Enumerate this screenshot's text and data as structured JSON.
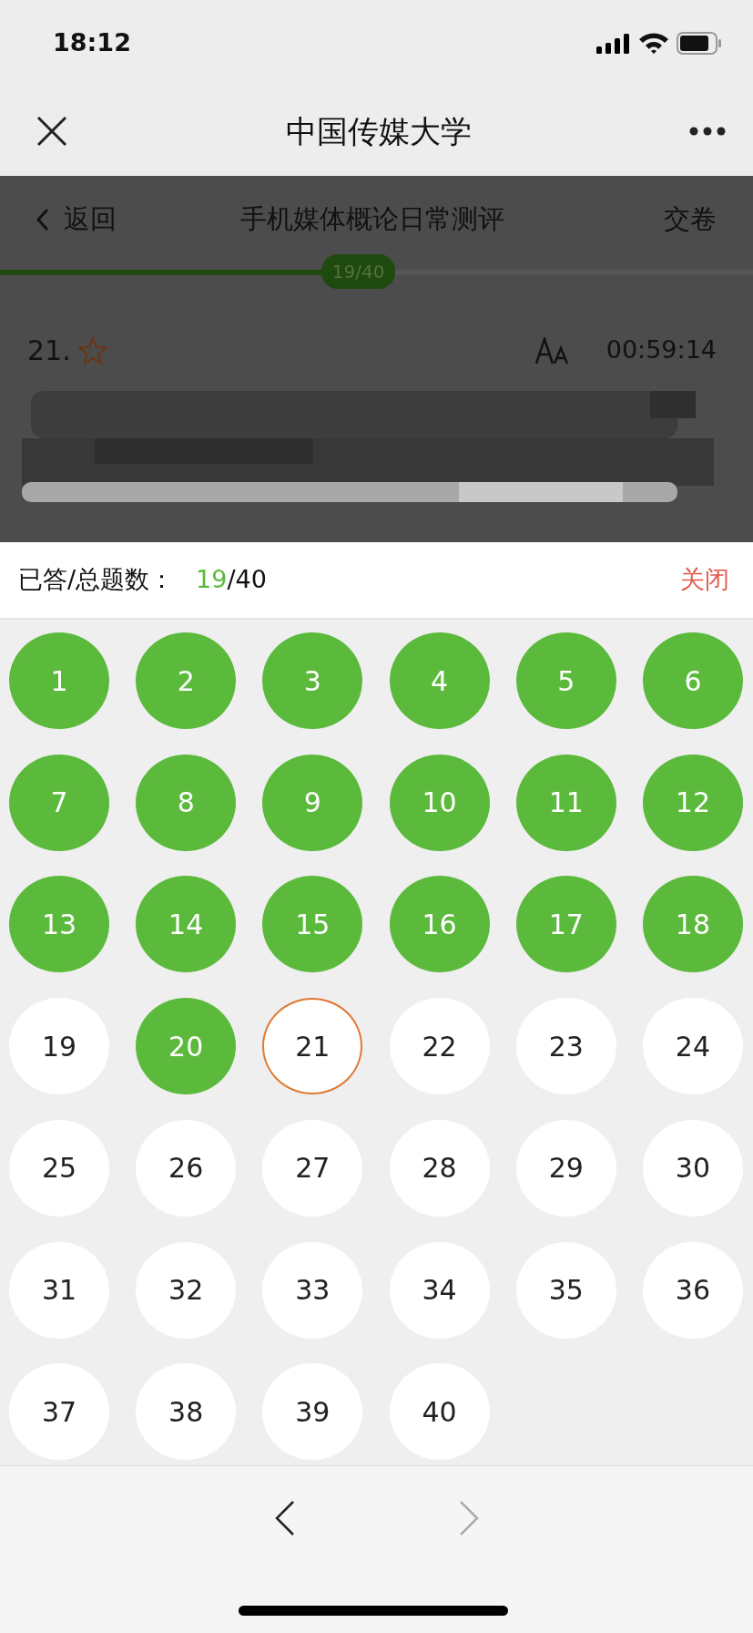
{
  "status_bar": {
    "time": "18:12"
  },
  "app_bar": {
    "title": "中国传媒大学"
  },
  "exam_header": {
    "back": "返回",
    "title": "手机媒体概论日常测评",
    "submit": "交卷"
  },
  "progress": {
    "level": 0.475,
    "label": "19/40"
  },
  "question": {
    "number": "21.",
    "timer": "00:59:14"
  },
  "answer_sheet": {
    "label": "已答/总题数：",
    "answered": "19",
    "total": "/40",
    "close": "关闭",
    "questions": [
      {
        "label": "1",
        "answered": true,
        "selected": false
      },
      {
        "label": "2",
        "answered": true,
        "selected": false
      },
      {
        "label": "3",
        "answered": true,
        "selected": false
      },
      {
        "label": "4",
        "answered": true,
        "selected": false
      },
      {
        "label": "5",
        "answered": true,
        "selected": false
      },
      {
        "label": "6",
        "answered": true,
        "selected": false
      },
      {
        "label": "7",
        "answered": true,
        "selected": false
      },
      {
        "label": "8",
        "answered": true,
        "selected": false
      },
      {
        "label": "9",
        "answered": true,
        "selected": false
      },
      {
        "label": "10",
        "answered": true,
        "selected": false
      },
      {
        "label": "11",
        "answered": true,
        "selected": false
      },
      {
        "label": "12",
        "answered": true,
        "selected": false
      },
      {
        "label": "13",
        "answered": true,
        "selected": false
      },
      {
        "label": "14",
        "answered": true,
        "selected": false
      },
      {
        "label": "15",
        "answered": true,
        "selected": false
      },
      {
        "label": "16",
        "answered": true,
        "selected": false
      },
      {
        "label": "17",
        "answered": true,
        "selected": false
      },
      {
        "label": "18",
        "answered": true,
        "selected": false
      },
      {
        "label": "19",
        "answered": false,
        "selected": false
      },
      {
        "label": "20",
        "answered": true,
        "selected": false
      },
      {
        "label": "21",
        "answered": false,
        "selected": true
      },
      {
        "label": "22",
        "answered": false,
        "selected": false
      },
      {
        "label": "23",
        "answered": false,
        "selected": false
      },
      {
        "label": "24",
        "answered": false,
        "selected": false
      },
      {
        "label": "25",
        "answered": false,
        "selected": false
      },
      {
        "label": "26",
        "answered": false,
        "selected": false
      },
      {
        "label": "27",
        "answered": false,
        "selected": false
      },
      {
        "label": "28",
        "answered": false,
        "selected": false
      },
      {
        "label": "29",
        "answered": false,
        "selected": false
      },
      {
        "label": "30",
        "answered": false,
        "selected": false
      },
      {
        "label": "31",
        "answered": false,
        "selected": false
      },
      {
        "label": "32",
        "answered": false,
        "selected": false
      },
      {
        "label": "33",
        "answered": false,
        "selected": false
      },
      {
        "label": "34",
        "answered": false,
        "selected": false
      },
      {
        "label": "35",
        "answered": false,
        "selected": false
      },
      {
        "label": "36",
        "answered": false,
        "selected": false
      },
      {
        "label": "37",
        "answered": false,
        "selected": false
      },
      {
        "label": "38",
        "answered": false,
        "selected": false
      },
      {
        "label": "39",
        "answered": false,
        "selected": false
      },
      {
        "label": "40",
        "answered": false,
        "selected": false
      }
    ]
  },
  "pager": {
    "next_disabled": true
  }
}
